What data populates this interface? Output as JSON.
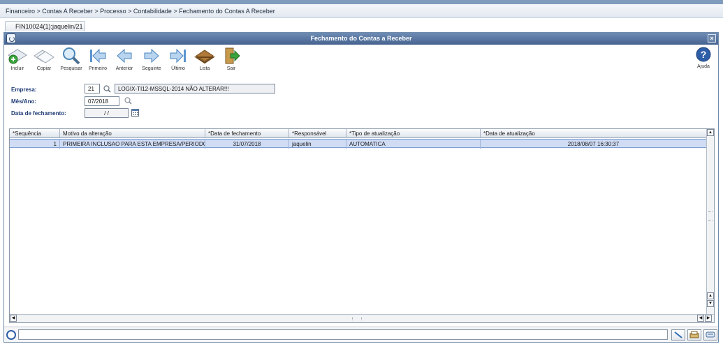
{
  "breadcrumb": "Financeiro > Contas A Receber > Processo > Contabilidade > Fechamento do Contas A Receber",
  "tab": {
    "label": "FIN10024(1):jaquelin/21"
  },
  "window": {
    "title": "Fechamento do Contas a Receber",
    "close_glyph": "×"
  },
  "toolbar": {
    "items": [
      {
        "label": "Incluir",
        "icon": "add-icon"
      },
      {
        "label": "Copiar",
        "icon": "copy-icon"
      },
      {
        "label": "Pesquisar",
        "icon": "search-icon"
      },
      {
        "label": "Primeiro",
        "icon": "first-icon"
      },
      {
        "label": "Anterior",
        "icon": "previous-icon"
      },
      {
        "label": "Seguinte",
        "icon": "next-icon"
      },
      {
        "label": "Último",
        "icon": "last-icon"
      },
      {
        "label": "Lista",
        "icon": "list-icon"
      },
      {
        "label": "Sair",
        "icon": "exit-icon"
      }
    ],
    "help_label": "Ajuda"
  },
  "form": {
    "empresa_label": "Empresa:",
    "empresa_code": "21",
    "empresa_name": "LOGIX-TI12-MSSQL-2014 NÃO ALTERAR!!!",
    "mes_ano_label": "Mês/Ano:",
    "mes_ano_value": "07/2018",
    "data_label": "Data de fechamento:",
    "data_value": "/ /"
  },
  "grid": {
    "columns": [
      "*Sequência",
      "Motivo da alteração",
      "*Data de fechamento",
      "*Responsável",
      "*Tipo de atualização",
      "*Data de atualização"
    ],
    "rows": [
      [
        "1",
        "PRIMEIRA INCLUSAO PARA ESTA EMPRESA/PERIODO.",
        "31/07/2018",
        "jaquelin",
        "AUTOMATICA",
        "2018/08/07 16:30:37"
      ]
    ]
  },
  "colors": {
    "title_bar": "#45638f",
    "label_blue": "#1d3a73",
    "selected_row": "#cfdcf4"
  }
}
